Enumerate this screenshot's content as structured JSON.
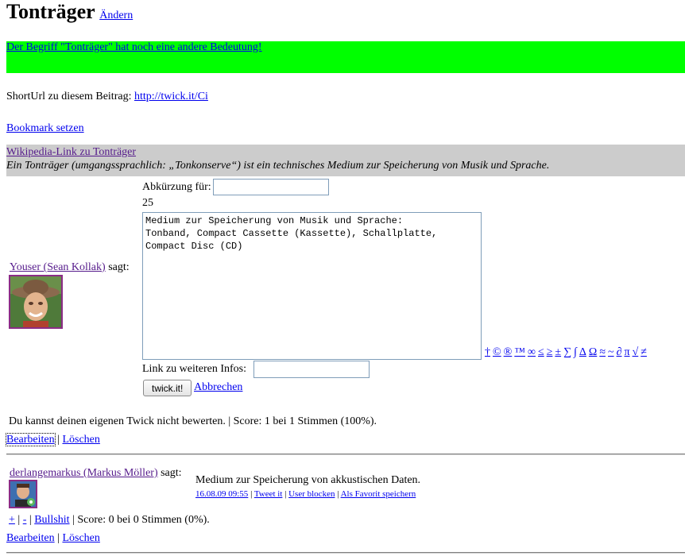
{
  "header": {
    "title": "Tonträger",
    "edit_link": "Ändern"
  },
  "notice": {
    "text": "Der Begriff \"Tonträger\" hat noch eine andere Bedeutung!"
  },
  "shorturl": {
    "label": "ShortUrl zu diesem Beitrag:",
    "url": "http://twick.it/Ci"
  },
  "bookmark": {
    "label": "Bookmark setzen"
  },
  "wikipedia": {
    "link": "Wikipedia-Link zu Tonträger",
    "definition": "Ein Tonträger (umgangssprachlich: „Tonkonserve“) ist ein technisches Medium zur Speicherung von Musik und Sprache."
  },
  "edit_form": {
    "author": "Youser (Sean Kollak)",
    "says": "sagt:",
    "abbrev_label": "Abkürzung für:",
    "abbrev_value": "",
    "char_count": "25",
    "text_value": "Medium zur Speicherung von Musik und Sprache:\nTonband, Compact Cassette (Kassette), Schallplatte,\nCompact Disc (CD)",
    "special_chars": [
      "†",
      "©",
      "®",
      "™",
      "∞",
      "≤",
      "≥",
      "±",
      "∑",
      "∫",
      "Δ",
      "Ω",
      "≈",
      "~",
      "∂",
      "π",
      "√",
      "≠"
    ],
    "link_label": "Link zu weiteren Infos:",
    "link_value": "",
    "submit": "twick.it!",
    "cancel": "Abbrechen"
  },
  "own_twick": {
    "rating_note": "Du kannst deinen eigenen Twick nicht bewerten. | Score: 1 bei 1 Stimmen (100%).",
    "edit": "Bearbeiten",
    "sep": "|",
    "delete": "Löschen"
  },
  "twick2": {
    "author": "derlangemarkus (Markus Möller)",
    "says": "sagt:",
    "text": "Medium zur Speicherung von akkustischen Daten.",
    "meta": {
      "date": "16.08.09 09:55",
      "tweet": "Tweet it",
      "block": "User blocken",
      "favorite": "Als Favorit speichern",
      "sep": "|"
    },
    "vote": {
      "plus": "+",
      "minus": "-",
      "bullshit": "Bullshit",
      "score": "| Score: 0 bei 0 Stimmen (0%)."
    },
    "edit": "Bearbeiten",
    "sep": "|",
    "delete": "Löschen"
  }
}
